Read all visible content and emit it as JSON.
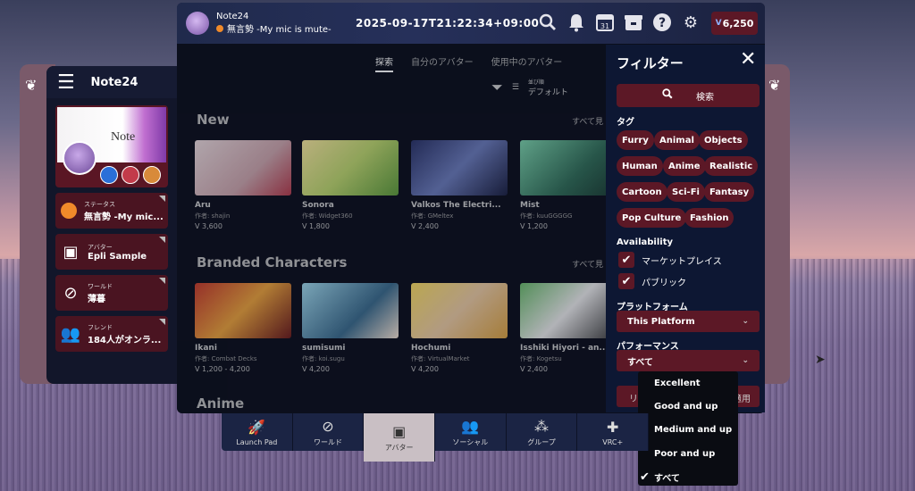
{
  "app": {
    "left_menu_title": "Note24"
  },
  "profile": {
    "banner_text": "Note"
  },
  "left_menu": {
    "items": [
      {
        "small": "ステータス",
        "big": "無言勢 -My mic...",
        "icon": "status-dot-icon"
      },
      {
        "small": "アバター",
        "big": "Epli Sample",
        "icon": "avatar-icon"
      },
      {
        "small": "ワールド",
        "big": "薄暮",
        "icon": "world-icon"
      },
      {
        "small": "フレンド",
        "big": "184人がオンラ...",
        "icon": "friends-icon"
      }
    ]
  },
  "header": {
    "username": "Note24",
    "status": "無言勢 -My mic is mute-",
    "datetime": "2025-09-17T21:22:34+09:00",
    "currency_symbol": "V",
    "currency": "6,250",
    "icons": [
      "search-icon",
      "notification-bell-icon",
      "calendar-icon",
      "store-icon",
      "help-icon",
      "settings-gear-icon"
    ],
    "calendar_day": "31"
  },
  "content": {
    "tabs": [
      "探索",
      "自分のアバター",
      "使用中のアバター"
    ],
    "sort_small": "並び順",
    "sort_value": "デフォルト",
    "see_all": "すべて見",
    "sections": [
      {
        "title": "New",
        "cards": [
          {
            "title": "Aru",
            "author": "作者: shajin",
            "price": "V 3,600"
          },
          {
            "title": "Sonora",
            "author": "作者: Widget360",
            "price": "V 1,800"
          },
          {
            "title": "Valkos The Electri...",
            "author": "作者: GMeltex",
            "price": "V 2,400"
          },
          {
            "title": "Mist",
            "author": "作者: kuuGGGGG",
            "price": "V 1,200"
          }
        ]
      },
      {
        "title": "Branded Characters",
        "cards": [
          {
            "title": "Ikani",
            "author": "作者: Combat Decks",
            "price": "V 1,200 - 4,200"
          },
          {
            "title": "sumisumi",
            "author": "作者: koi.sugu",
            "price": "V 4,200"
          },
          {
            "title": "Hochumi",
            "author": "作者: VirtualMarket",
            "price": "V 4,200"
          },
          {
            "title": "Isshiki Hiyori - an...",
            "author": "作者: Kogetsu",
            "price": "V 2,400"
          }
        ]
      },
      {
        "title": "Anime"
      }
    ]
  },
  "filter": {
    "title": "フィルター",
    "search_label": "検索",
    "tags_label": "タグ",
    "tags": [
      "Furry",
      "Animal",
      "Objects",
      "Human",
      "Anime",
      "Realistic",
      "Cartoon",
      "Sci-Fi",
      "Fantasy",
      "Pop Culture",
      "Fashion"
    ],
    "availability_label": "Availability",
    "availability": [
      "マーケットプレイス",
      "パブリック"
    ],
    "platform_label": "プラットフォーム",
    "platform_value": "This Platform",
    "performance_label": "パフォーマンス",
    "performance_value": "すべて",
    "reset_label": "リセ",
    "apply_label": "適用"
  },
  "performance_dropdown": {
    "options": [
      "Excellent",
      "Good and up",
      "Medium and up",
      "Poor and up",
      "すべて"
    ],
    "selected_index": 4
  },
  "bottom_nav": {
    "items": [
      {
        "label": "Launch Pad",
        "icon": "rocket-icon"
      },
      {
        "label": "ワールド",
        "icon": "planet-icon"
      },
      {
        "label": "アバター",
        "icon": "avatar-icon"
      },
      {
        "label": "ソーシャル",
        "icon": "social-icon"
      },
      {
        "label": "グループ",
        "icon": "group-icon"
      },
      {
        "label": "VRC+",
        "icon": "vrc-plus-icon"
      }
    ],
    "active_index": 2
  }
}
